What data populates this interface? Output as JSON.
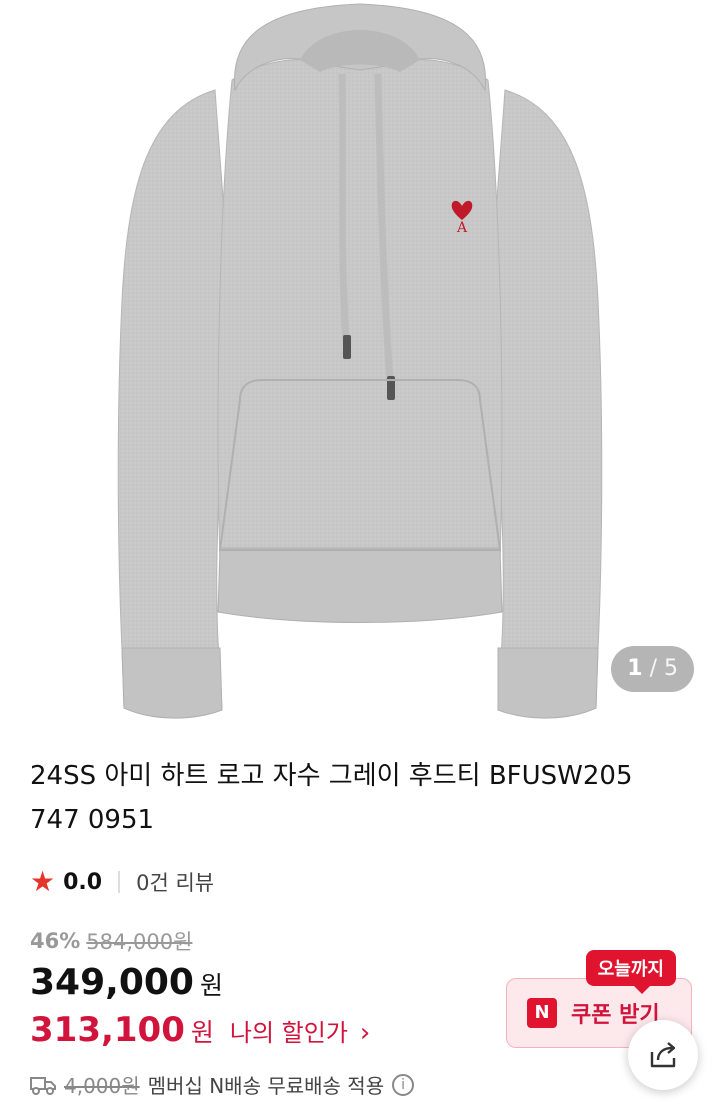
{
  "gallery": {
    "current": "1",
    "separator": "/",
    "total": "5"
  },
  "product": {
    "title": "24SS 아미 하트 로고 자수 그레이 후드티 BFUSW205 747 0951"
  },
  "rating": {
    "score": "0.0",
    "reviews": "0건 리뷰"
  },
  "pricing": {
    "discount_pct": "46%",
    "original_price": "584,000원",
    "price": "349,000",
    "currency": "원",
    "my_price": "313,100",
    "my_price_label": "나의 할인가",
    "my_price_chevron": "›"
  },
  "shipping": {
    "original_fee": "4,000원",
    "text": "멤버십 N배송 무료배송 적용",
    "info_glyph": "i"
  },
  "coupon": {
    "tag": "오늘까지",
    "badge": "N",
    "label": "쿠폰 받기"
  },
  "colors": {
    "accent_red": "#d0143c",
    "coupon_bg": "#fde9ec",
    "hoodie_gray": "#c9c9c9"
  },
  "icons": {
    "star": "★",
    "share": "share-icon",
    "truck": "truck-icon"
  }
}
